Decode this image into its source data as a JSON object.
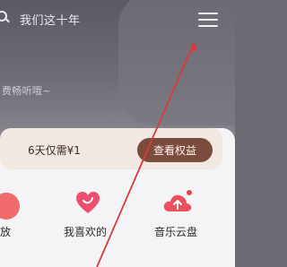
{
  "header": {
    "search_placeholder": "我们这十年",
    "subtitle": "费畅听哦~"
  },
  "vip_banner": {
    "text": "6天仅需¥1",
    "button_label": "查看权益"
  },
  "tiles": [
    {
      "label": "播放",
      "icon": "play-icon"
    },
    {
      "label": "我喜欢的",
      "icon": "heart-icon"
    },
    {
      "label": "音乐云盘",
      "icon": "cloud-upload-icon"
    }
  ],
  "colors": {
    "accent": "#e8454b",
    "vip_button": "#7b4b3d",
    "annotation_arrow": "#d93a3a"
  }
}
